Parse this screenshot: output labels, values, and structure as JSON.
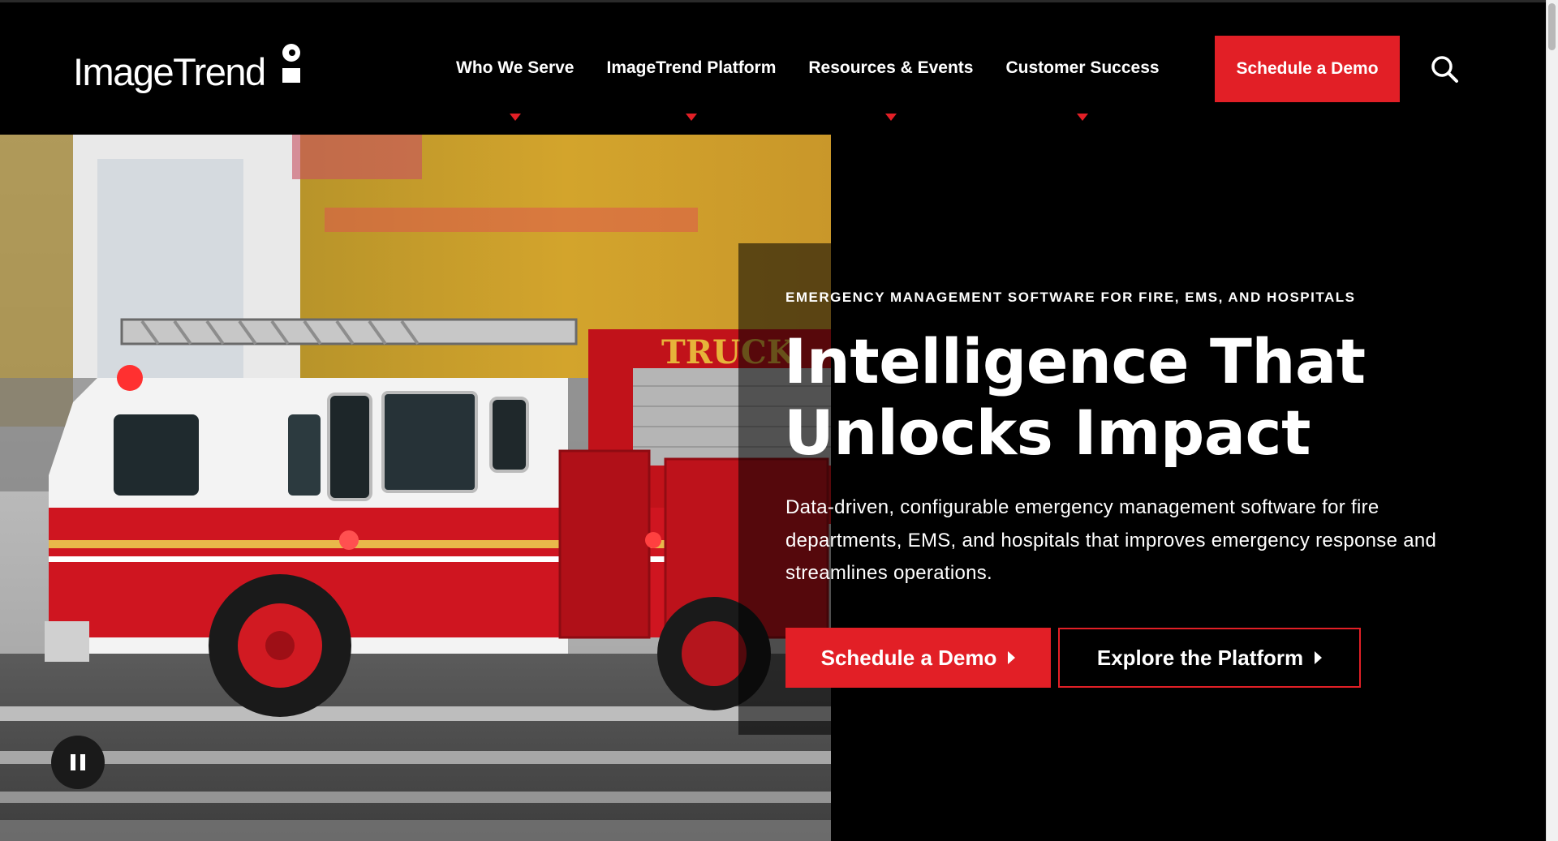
{
  "header": {
    "logo_text": "ImageTrend",
    "nav": [
      {
        "label": "Who We Serve"
      },
      {
        "label": "ImageTrend Platform"
      },
      {
        "label": "Resources & Events"
      },
      {
        "label": "Customer Success"
      }
    ],
    "cta_label": "Schedule a Demo",
    "search_icon": "search-icon"
  },
  "hero": {
    "image": "fire-truck-photo",
    "truck_sign": "TRUCK",
    "eyebrow": "EMERGENCY MANAGEMENT SOFTWARE FOR FIRE, EMS, AND HOSPITALS",
    "headline_line1": "Intelligence That",
    "headline_line2": "Unlocks Impact",
    "subtext": "Data-driven, configurable emergency management software for fire departments, EMS, and hospitals that improves emergency response and streamlines operations.",
    "primary_button": "Schedule a Demo",
    "secondary_button": "Explore the Platform",
    "pause_icon": "pause-icon"
  },
  "colors": {
    "background": "#000000",
    "accent_red": "#e21f26",
    "text": "#ffffff"
  }
}
